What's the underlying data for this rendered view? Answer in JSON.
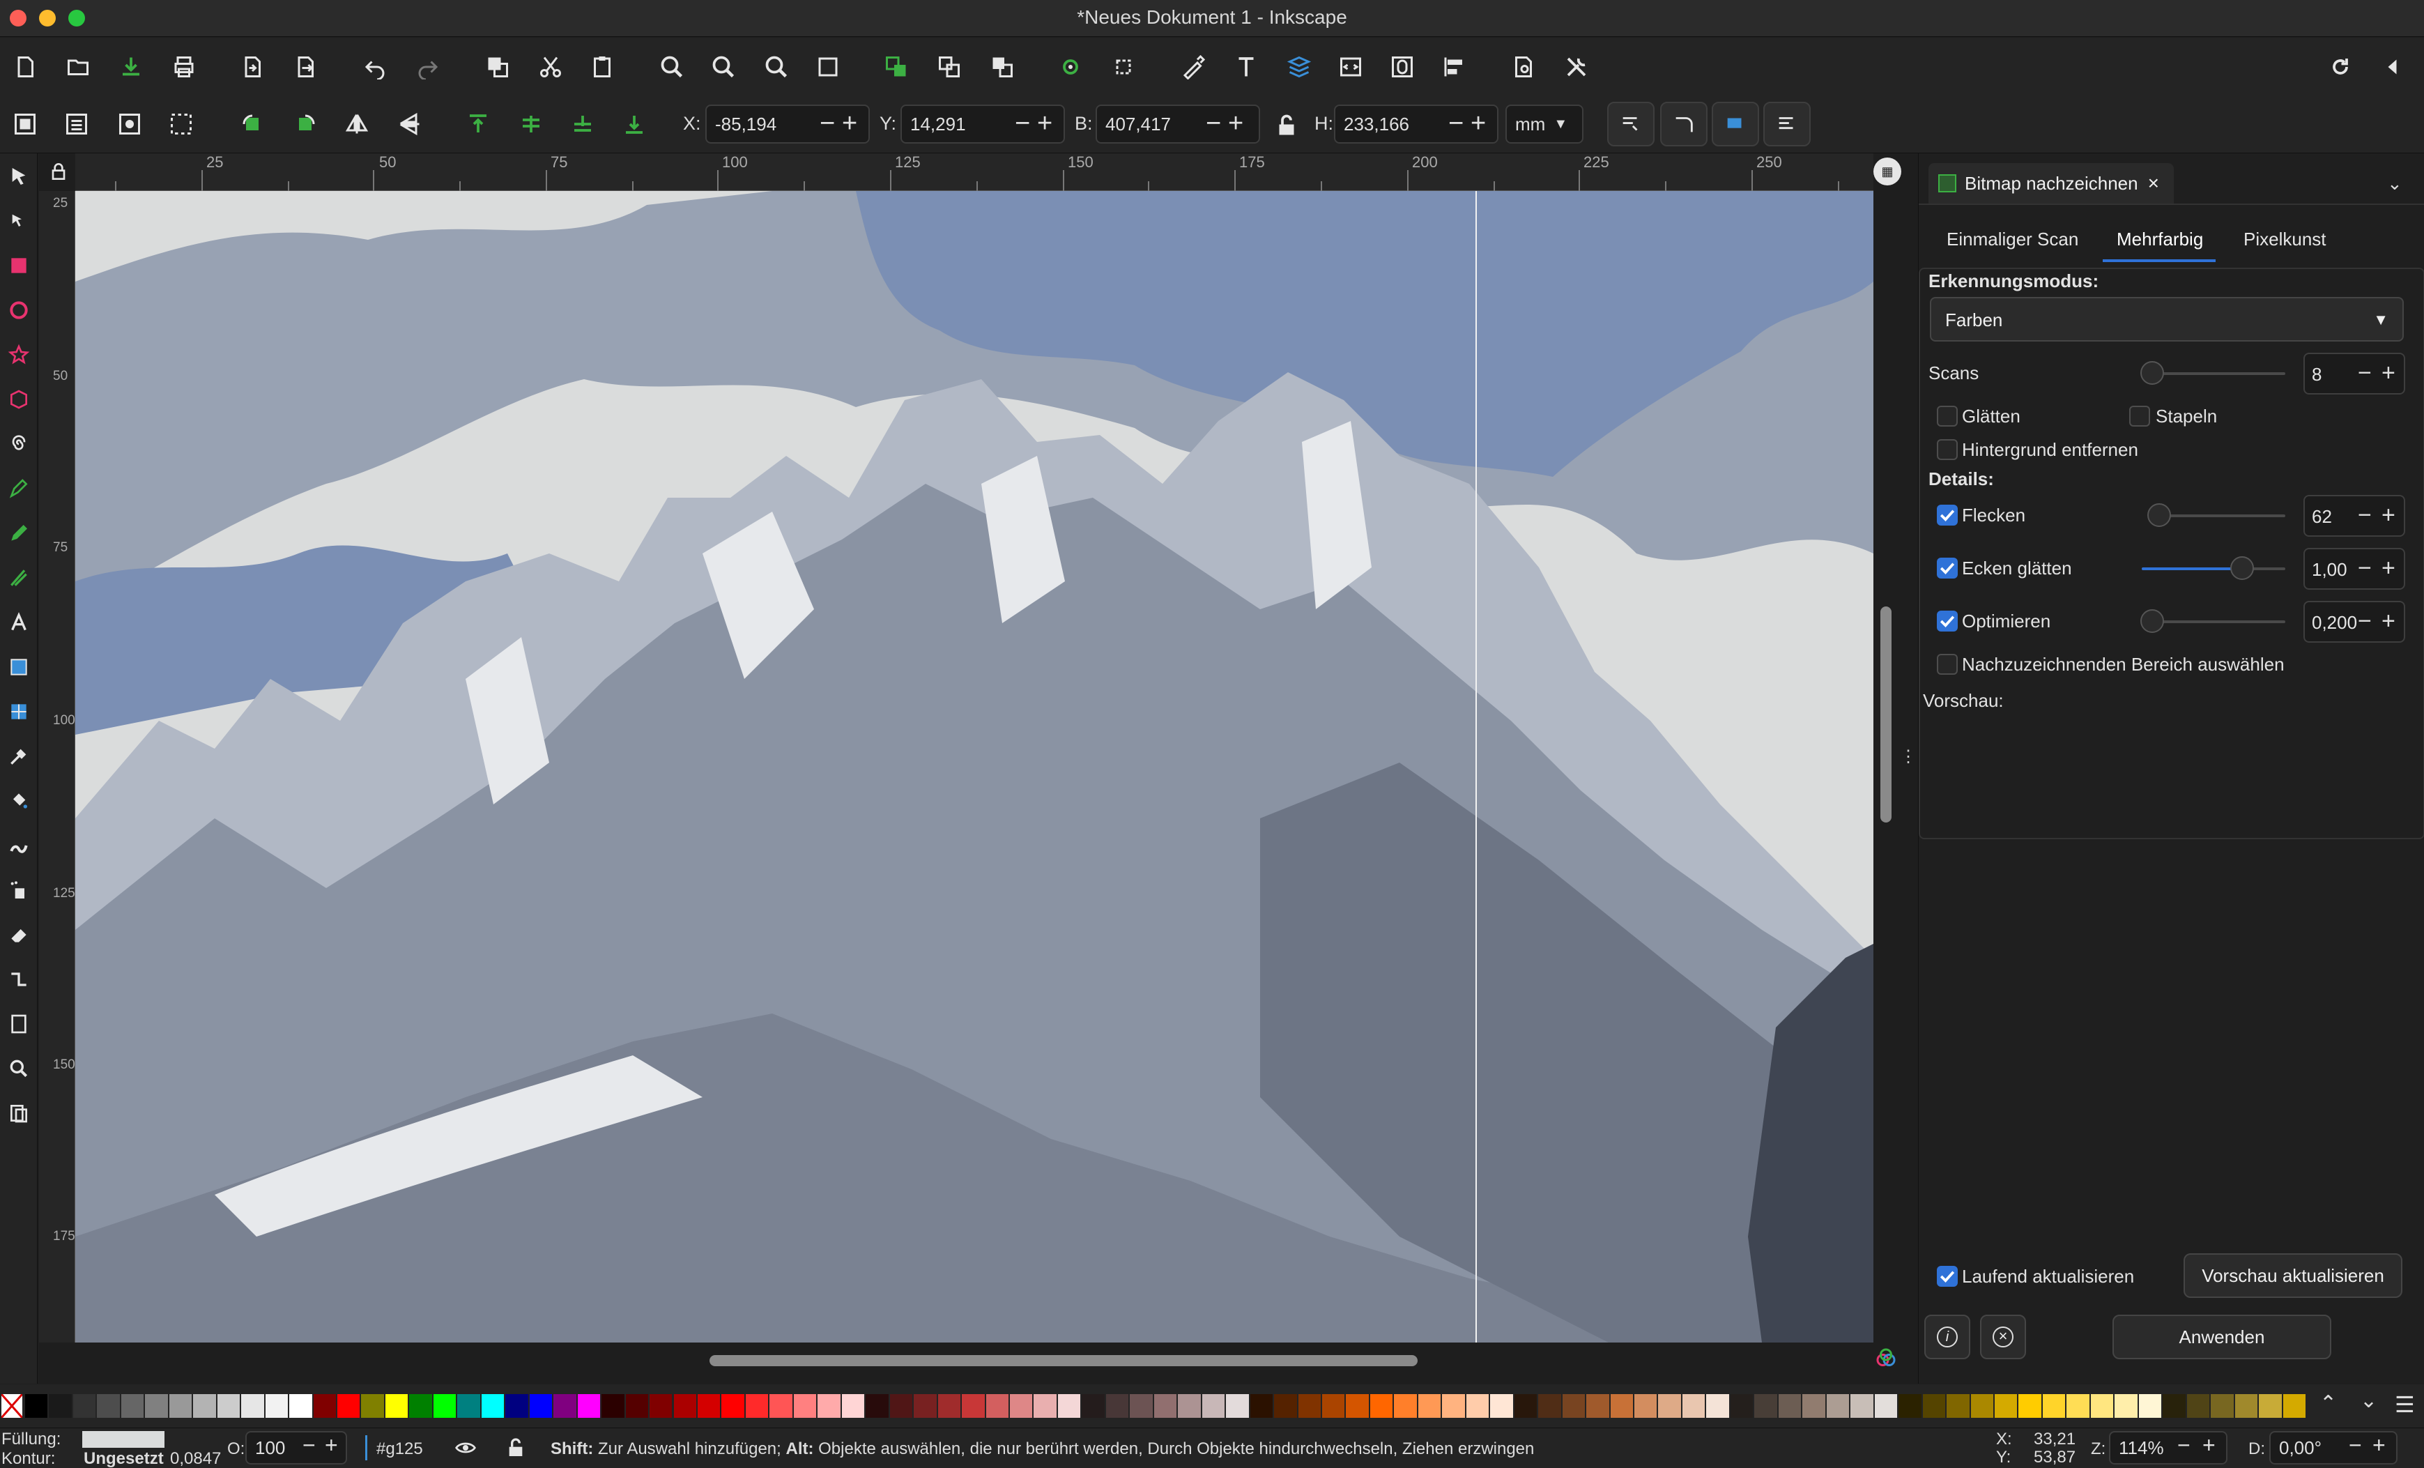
{
  "window": {
    "title": "*Neues Dokument 1 - Inkscape"
  },
  "icons": {
    "commands": [
      "new-document-icon",
      "open-icon",
      "save-icon",
      "print-icon",
      "import-icon",
      "export-icon",
      "undo-icon",
      "redo-icon",
      "duplicate-icon",
      "cut-icon",
      "paste-icon",
      "zoom-selection-icon",
      "zoom-drawing-icon",
      "zoom-page-icon",
      "zoom-width-icon",
      "group-icon",
      "ungroup-icon",
      "clone-icon",
      "unlink-clone-icon",
      "to-path-icon",
      "xml-editor-icon",
      "text-font-icon",
      "layers-icon",
      "objects-icon",
      "symbols-icon",
      "align-distribute-icon",
      "document-properties-icon",
      "preferences-icon"
    ],
    "tools": [
      "selector-tool-icon",
      "node-tool-icon",
      "rectangle-tool-icon",
      "ellipse-tool-icon",
      "star-tool-icon",
      "3d-box-tool-icon",
      "spiral-tool-icon",
      "pen-tool-icon",
      "pencil-tool-icon",
      "calligraphy-tool-icon",
      "text-tool-icon",
      "gradient-tool-icon",
      "mesh-tool-icon",
      "dropper-tool-icon",
      "paint-bucket-tool-icon",
      "tweak-tool-icon",
      "spray-tool-icon",
      "eraser-tool-icon",
      "connector-tool-icon",
      "pages-tool-icon",
      "zoom-tool-icon",
      "measure-tool-icon"
    ]
  },
  "toolbar": {
    "x_label": "X:",
    "x_value": "-85,194",
    "y_label": "Y:",
    "y_value": "14,291",
    "w_label": "B:",
    "w_value": "407,417",
    "h_label": "H:",
    "h_value": "233,166",
    "unit": "mm"
  },
  "ruler": {
    "h_ticks": [
      "25",
      "50",
      "75",
      "100",
      "125",
      "150",
      "175",
      "200",
      "225",
      "250"
    ],
    "v_ticks": [
      "25",
      "50",
      "75",
      "100",
      "125",
      "150",
      "175"
    ]
  },
  "panel": {
    "tab_title": "Bitmap nachzeichnen",
    "subtabs": [
      "Einmaliger Scan",
      "Mehrfarbig",
      "Pixelkunst"
    ],
    "active_subtab": "Mehrfarbig",
    "mode_label": "Erkennungsmodus:",
    "mode_value": "Farben",
    "scans_label": "Scans",
    "scans_value": "8",
    "scans_level": 0,
    "smooth_label": "Glätten",
    "smooth_checked": false,
    "stack_label": "Stapeln",
    "stack_checked": false,
    "remove_bg_label": "Hintergrund entfernen",
    "remove_bg_checked": false,
    "details_label": "Details:",
    "speckles_label": "Flecken",
    "speckles_value": "62",
    "speckles_checked": true,
    "speckles_level": 0,
    "corners_label": "Ecken glätten",
    "corners_value": "1,00",
    "corners_checked": true,
    "corners_level": 0.75,
    "optimize_label": "Optimieren",
    "optimize_value": "0,200",
    "optimize_checked": true,
    "optimize_level": 0,
    "area_label": "Nachzuzeichnenden Bereich auswählen",
    "area_checked": false,
    "preview_label": "Vorschau:",
    "live_label": "Laufend aktualisieren",
    "live_checked": true,
    "update_button": "Vorschau aktualisieren",
    "apply_button": "Anwenden"
  },
  "palette_colors": [
    "#000000",
    "#1a1a1a",
    "#333333",
    "#4d4d4d",
    "#666666",
    "#808080",
    "#999999",
    "#b3b3b3",
    "#cccccc",
    "#e6e6e6",
    "#f2f2f2",
    "#ffffff",
    "#800000",
    "#ff0000",
    "#808000",
    "#ffff00",
    "#008000",
    "#00ff00",
    "#008080",
    "#00ffff",
    "#000080",
    "#0000ff",
    "#800080",
    "#ff00ff",
    "#2b0000",
    "#550000",
    "#800000",
    "#aa0000",
    "#d40000",
    "#ff0000",
    "#ff2a2a",
    "#ff5555",
    "#ff8080",
    "#ffaaaa",
    "#ffd5d5",
    "#280b0b",
    "#501616",
    "#782121",
    "#a02c2c",
    "#c83737",
    "#d35f5f",
    "#de8787",
    "#e9afaf",
    "#f4d7d7",
    "#241c1c",
    "#483737",
    "#6c5353",
    "#916f6f",
    "#ac9393",
    "#c8b7b7",
    "#e3dbdb",
    "#2b1100",
    "#552200",
    "#803300",
    "#aa4400",
    "#d45500",
    "#ff6600",
    "#ff7f2a",
    "#ff9955",
    "#ffb380",
    "#ffccaa",
    "#ffe6d5",
    "#28170b",
    "#502d16",
    "#784421",
    "#a05a2c",
    "#c87137",
    "#d38d5f",
    "#deaa87",
    "#e9c6af",
    "#f4e3d7",
    "#241f1c",
    "#483e37",
    "#6c5d53",
    "#917c6f",
    "#ac9d93",
    "#c8beb7",
    "#e3dedb",
    "#2b2200",
    "#554400",
    "#806600",
    "#aa8800",
    "#d4aa00",
    "#ffcc00",
    "#ffd42a",
    "#ffdd55",
    "#ffe680",
    "#ffeeaa",
    "#fff6d5",
    "#28220b",
    "#504416",
    "#786721",
    "#a0892c",
    "#c8ab37",
    "#d4aa00"
  ],
  "status": {
    "fill_label": "Füllung:",
    "stroke_label": "Kontur:",
    "stroke_value": "Ungesetzt",
    "stroke_width": "0,0847",
    "opacity_label": "O:",
    "opacity_value": "100",
    "layer": "#g125",
    "message_shift": "Shift:",
    "message_shift_text": " Zur Auswahl hinzufügen; ",
    "message_alt": "Alt:",
    "message_alt_text": " Objekte auswählen, die nur berührt werden, Durch Objekte hindurchwechseln, Ziehen erzwingen",
    "cursor_x_label": "X:",
    "cursor_x": "33,21",
    "cursor_y_label": "Y:",
    "cursor_y": "53,87",
    "zoom_label": "Z:",
    "zoom_value": "114%",
    "rotate_label": "D:",
    "rotate_value": "0,00°"
  },
  "colors": {
    "accent": "#2f72d8",
    "checkbox": "#2f72d8",
    "panel_bg": "#1f1f1f",
    "toolbar_bg": "#242424"
  }
}
